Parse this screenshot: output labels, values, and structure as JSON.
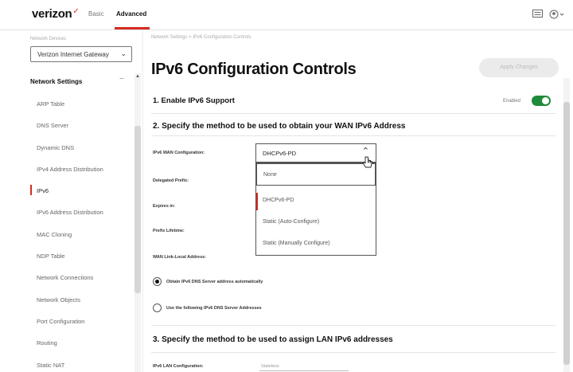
{
  "header": {
    "brand": "verizon",
    "brand_mark": "✓",
    "nav_basic": "Basic",
    "nav_advanced": "Advanced",
    "icons": [
      "message-icon",
      "account-icon"
    ]
  },
  "sidebar": {
    "gateway_caption": "Network Devices",
    "gateway_select": "Verizon Internet Gateway",
    "section_title": "Network Settings",
    "collapse_glyph": "−",
    "items": [
      {
        "label": "ARP Table"
      },
      {
        "label": "DNS Server"
      },
      {
        "label": "Dynamic DNS"
      },
      {
        "label": "IPv4 Address Distribution"
      },
      {
        "label": "IPv6"
      },
      {
        "label": "IPv6 Address Distribution"
      },
      {
        "label": "MAC Cloning"
      },
      {
        "label": "NDP Table"
      },
      {
        "label": "Network Connections"
      },
      {
        "label": "Network Objects"
      },
      {
        "label": "Port Configuration"
      },
      {
        "label": "Routing"
      },
      {
        "label": "Static NAT"
      }
    ],
    "active_item": "IPv6"
  },
  "main": {
    "breadcrumb": "Network Settings  >  IPv6 Configuration Controls",
    "title": "IPv6 Configuration Controls",
    "apply_button": "Apply Changes",
    "section1": "1. Enable IPv6 Support",
    "toggle_label": "Enabled",
    "toggle_on": true,
    "section2": "2. Specify the method to be used to obtain your WAN IPv6 Address",
    "wan_config_label": "IPv6 WAN Configuration:",
    "wan_config_value": "DHCPv6-PD",
    "wan_options": [
      "None",
      "DHCPv6-PD",
      "Static (Auto-Configure)",
      "Static (Manually Configure)"
    ],
    "delegated_prefix_label": "Delegated Prefix:",
    "expires_label": "Expires in:",
    "prefix_lifetime_label": "Prefix Lifetime:",
    "wan_link_local_label": "WAN Link-Local Address:",
    "dns_auto_label": "Obtain IPv6 DNS Server address automatically",
    "dns_manual_label": "Use the following IPv6 DNS Server Addresses",
    "section3": "3. Specify the method to be used to assign LAN IPv6 addresses",
    "lan_config_label": "IPv6 LAN Configuration:",
    "lan_config_value": "Stateless"
  },
  "colors": {
    "accent": "#d52b1e",
    "toggle_on": "#1f8a3a"
  }
}
